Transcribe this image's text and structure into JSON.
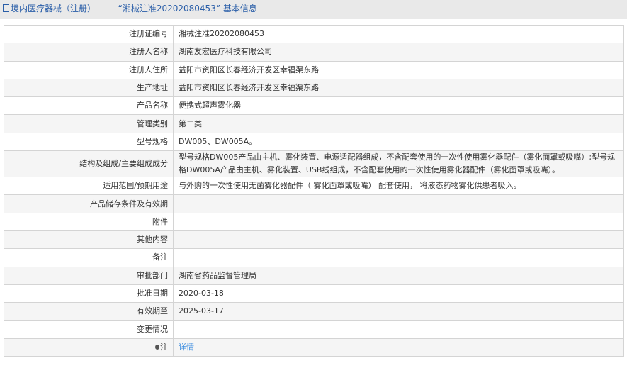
{
  "header": {
    "title": "境内医疗器械（注册） —— “湘械注准20202080453” 基本信息"
  },
  "rows": [
    {
      "label": "注册证编号",
      "value": "湘械注准20202080453"
    },
    {
      "label": "注册人名称",
      "value": "湖南友宏医疗科技有限公司"
    },
    {
      "label": "注册人住所",
      "value": "益阳市资阳区长春经济开发区幸福渠东路"
    },
    {
      "label": "生产地址",
      "value": "益阳市资阳区长春经济开发区幸福渠东路"
    },
    {
      "label": "产品名称",
      "value": "便携式超声雾化器"
    },
    {
      "label": "管理类别",
      "value": "第二类"
    },
    {
      "label": "型号规格",
      "value": "DW005、DW005A。"
    },
    {
      "label": "结构及组成/主要组成成分",
      "value": "型号规格DW005产品由主机、雾化装置、电源适配器组成，不含配套使用的一次性使用雾化器配件（雾化面罩或吸嘴）;型号规格DW005A产品由主机、雾化装置、USB线组成，不含配套使用的一次性使用雾化器配件（雾化面罩或吸嘴）。"
    },
    {
      "label": "适用范围/预期用途",
      "value": "与外购的一次性使用无菌雾化器配件（ 雾化面罩或吸嘴） 配套使用， 将液态药物雾化供患者吸入。"
    },
    {
      "label": "产品储存条件及有效期",
      "value": ""
    },
    {
      "label": "附件",
      "value": ""
    },
    {
      "label": "其他内容",
      "value": ""
    },
    {
      "label": "备注",
      "value": ""
    },
    {
      "label": "审批部门",
      "value": "湖南省药品监督管理局"
    },
    {
      "label": "批准日期",
      "value": "2020-03-18"
    },
    {
      "label": "有效期至",
      "value": "2025-03-17"
    },
    {
      "label": "变更情况",
      "value": ""
    }
  ],
  "note": {
    "label": "注",
    "link": "详情"
  }
}
